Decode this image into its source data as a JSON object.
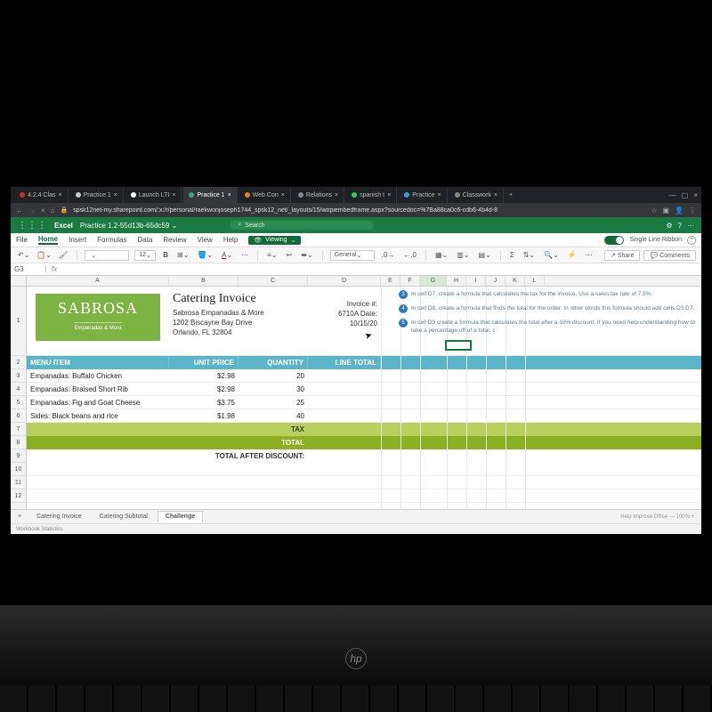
{
  "browser": {
    "tabs": [
      {
        "label": "4.2.4 Clas",
        "fav": "#c0392b"
      },
      {
        "label": "Practice 1",
        "fav": "#ccc"
      },
      {
        "label": "Launch LTI",
        "fav": "#fff"
      },
      {
        "label": "Practice 1",
        "fav": "#3a7",
        "active": true
      },
      {
        "label": "Web Con",
        "fav": "#e67e22"
      },
      {
        "label": "Relations",
        "fav": "#888"
      },
      {
        "label": "spanish t",
        "fav": "#2ecc71"
      },
      {
        "label": "Practice",
        "fav": "#3498db"
      },
      {
        "label": "Classwork",
        "fav": "#888"
      }
    ],
    "url": "spsk12net-my.sharepoint.com/:x:/r/personal/raekwonjoseph1744_spsk12_net/_layouts/15/wopiembedframe.aspx?sourcedoc=%7Ba88ca0c6-cdb6-4b4d-8"
  },
  "excel": {
    "app": "Excel",
    "doc": "Practice 1.2-55d13b-65dc59",
    "search_placeholder": "Search",
    "menu": [
      "File",
      "Home",
      "Insert",
      "Formulas",
      "Data",
      "Review",
      "View",
      "Help"
    ],
    "menu_active": "Home",
    "viewing_label": "Viewing",
    "ribbon_toggle_label": "Single Line Ribbon",
    "share_label": "Share",
    "comments_label": "Comments",
    "font_size": "12",
    "number_format": "General",
    "cell_ref": "G3",
    "fx": "fx"
  },
  "columns": [
    "A",
    "B",
    "C",
    "D",
    "E",
    "F",
    "G",
    "H",
    "I",
    "J",
    "K",
    "L"
  ],
  "row_numbers": [
    "1",
    "2",
    "3",
    "4",
    "5",
    "6",
    "7",
    "8",
    "9",
    "10",
    "11",
    "12"
  ],
  "invoice": {
    "brand": "SABROSA",
    "brand_sub": "Empanadas & More",
    "title": "Catering Invoice",
    "biz_name": "Sabrosa Empanadas & More",
    "addr1": "1202 Biscayne Bay Drive",
    "addr2": "Orlando, FL 32804",
    "inv_label": "Invoice #:",
    "inv_num_date": "6710A Date:",
    "inv_date": "10/15/20",
    "headers": {
      "item": "MENU ITEM",
      "price": "UNIT PRICE",
      "qty": "QUANTITY",
      "total": "LINE TOTAL"
    },
    "rows": [
      {
        "item": "Empanadas: Buffalo Chicken",
        "price": "$2.98",
        "qty": "20"
      },
      {
        "item": "Empanadas: Braised Short Rib",
        "price": "$2.98",
        "qty": "30"
      },
      {
        "item": "Empanadas: Fig and Goat Cheese",
        "price": "$3.75",
        "qty": "25"
      },
      {
        "item": "Sides: Black beans and rice",
        "price": "$1.98",
        "qty": "40"
      }
    ],
    "tax_label": "TAX",
    "total_label": "TOTAL",
    "discount_label": "TOTAL AFTER DISCOUNT:"
  },
  "instructions": {
    "steps": [
      {
        "n": "3",
        "text": "In cell D7, create a formula that calculates the tax for the invoice. Use a sales tax rate of 7.5%."
      },
      {
        "n": "4",
        "text": "In cell D8, create a formula that finds the total for the order. In other words this formula should add cells D3:D7."
      },
      {
        "n": "5",
        "text": "In cell D9 create a formula that calculates the total after a 10% discount. If you need help understanding how to take a percentage off of a total, c"
      }
    ]
  },
  "sheets": {
    "tabs": [
      "Catering Invoice",
      "Catering Subtotal",
      "Challenge"
    ],
    "active": "Challenge",
    "status_left": "Workbook Statistics",
    "status_right": "Help Improve Office     — 100% +"
  },
  "laptop_brand": "hp"
}
